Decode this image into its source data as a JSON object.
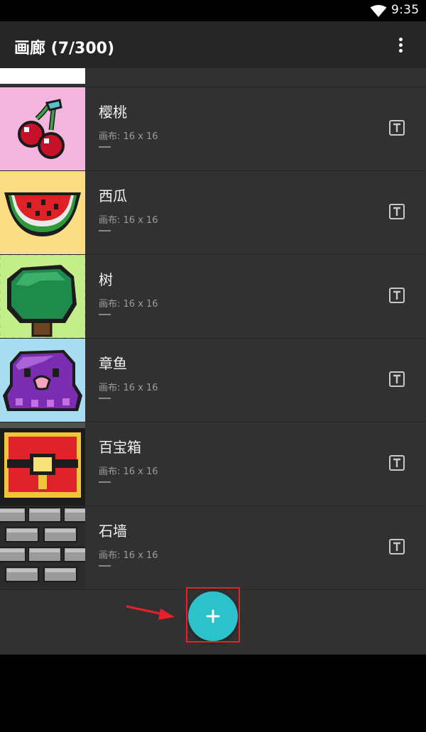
{
  "status_bar": {
    "time": "9:35",
    "wifi_icon": "wifi-icon"
  },
  "app_bar": {
    "title": "画廊 (7/300)",
    "menu_icon": "more-vert-icon"
  },
  "gallery": {
    "items": [
      {
        "name": "樱桃",
        "size": "画布: 16 x 16",
        "thumbnail": "cherry-thumbnail"
      },
      {
        "name": "西瓜",
        "size": "画布: 16 x 16",
        "thumbnail": "watermelon-thumbnail"
      },
      {
        "name": "树",
        "size": "画布: 16 x 16",
        "thumbnail": "tree-thumbnail"
      },
      {
        "name": "章鱼",
        "size": "画布: 16 x 16",
        "thumbnail": "octopus-thumbnail"
      },
      {
        "name": "百宝箱",
        "size": "画布: 16 x 16",
        "thumbnail": "treasure-chest-thumbnail"
      },
      {
        "name": "石墙",
        "size": "画布: 16 x 16",
        "thumbnail": "stone-wall-thumbnail"
      }
    ],
    "item_action_icon": "text-rename-icon"
  },
  "fab": {
    "icon": "plus-icon"
  },
  "annotation": {
    "color": "#e8202a"
  },
  "colors": {
    "accent": "#2dc1cc",
    "app_bar": "#262626",
    "list_background": "#313131"
  }
}
